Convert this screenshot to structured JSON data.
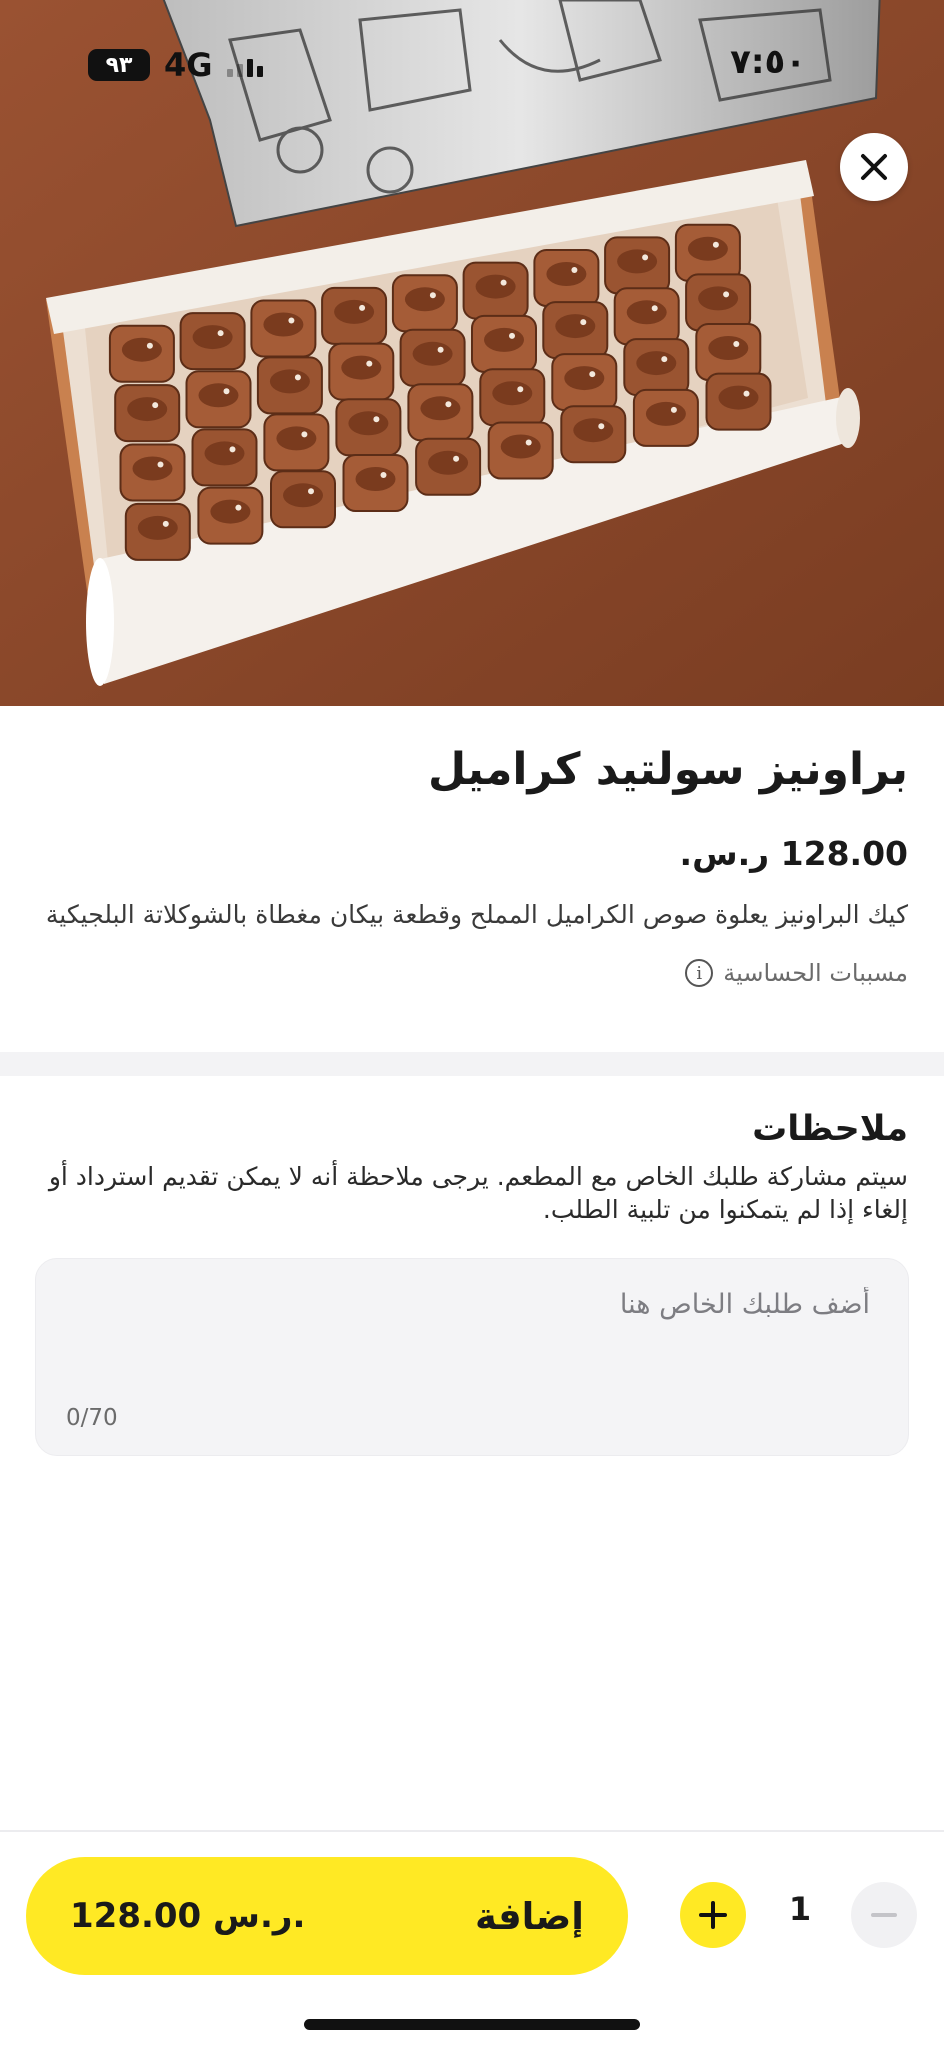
{
  "status_bar": {
    "time": "٧:٥٠",
    "network": "4G",
    "battery": "٩٣"
  },
  "product": {
    "title": "براونيز سولتيد كراميل",
    "price": "128.00 ر.س.",
    "description": "كيك البراونيز يعلوة صوص الكراميل المملح وقطعة بيكان مغطاة بالشوكلاتة البلجيكية",
    "allergens_label": "مسببات الحساسية"
  },
  "notes": {
    "title": "ملاحظات",
    "info_text": "سيتم مشاركة طلبك الخاص مع المطعم. يرجى ملاحظة أنه لا يمكن تقديم استرداد أو إلغاء إذا لم يتمكنوا من تلبية الطلب.",
    "placeholder": "أضف طلبك الخاص هنا",
    "value": "",
    "counter": "0/70"
  },
  "cart": {
    "add_label": "إضافة",
    "total_price": "128.00 ر.س.",
    "quantity": "1"
  },
  "colors": {
    "accent": "#ffe924",
    "hero_background": "#8d4a2c"
  },
  "icons": {
    "close": "close-icon",
    "plus": "plus-icon",
    "minus": "minus-icon",
    "info": "info-icon"
  }
}
